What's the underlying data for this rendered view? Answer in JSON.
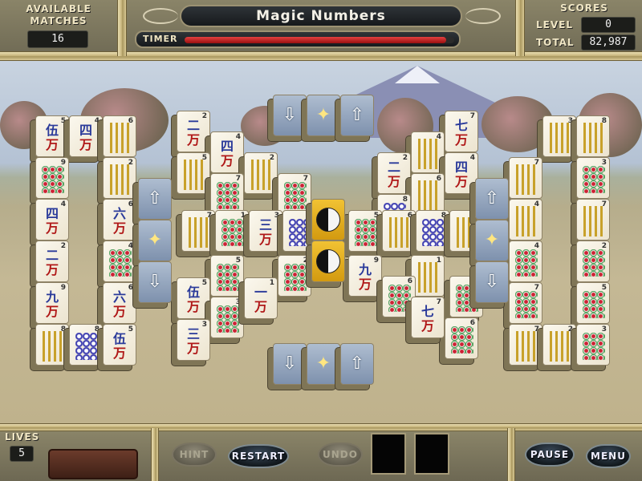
{
  "header": {
    "available_matches_label": "AVAILABLE\nMATCHES",
    "available_matches_value": "16",
    "title": "Magic Numbers",
    "timer_label": "TIMER",
    "timer_fraction": 0.97,
    "scores_label": "SCORES",
    "level_label": "LEVEL",
    "level_value": "0",
    "total_label": "TOTAL",
    "total_value": "82,987"
  },
  "footer": {
    "lives_label": "LIVES",
    "lives_value": "5",
    "hint_label": "HINT",
    "restart_label": "RESTART",
    "undo_label": "UNDO",
    "pause_label": "PAUSE",
    "menu_label": "MENU"
  },
  "colors": {
    "timer_bar": "#c41a1a",
    "special_tile": "#8ea0bb",
    "yin_yang_tile": "#e2ad1f"
  },
  "tiles": [
    {
      "id": "t1",
      "kind": "char",
      "glyph": "伍",
      "sub": "万",
      "num": "5"
    },
    {
      "id": "t2",
      "kind": "char",
      "glyph": "四",
      "sub": "万",
      "num": "4"
    },
    {
      "id": "t3",
      "kind": "bam",
      "num": "6"
    },
    {
      "id": "t4",
      "kind": "circ",
      "num": "9"
    },
    {
      "id": "t5",
      "kind": "bam",
      "num": "2"
    },
    {
      "id": "t6",
      "kind": "char",
      "glyph": "四",
      "sub": "万",
      "num": "4"
    },
    {
      "id": "t7",
      "kind": "char",
      "glyph": "六",
      "sub": "万",
      "num": "6"
    },
    {
      "id": "t8",
      "kind": "char",
      "glyph": "二",
      "sub": "万",
      "num": "2"
    },
    {
      "id": "t9",
      "kind": "circ",
      "num": "4"
    },
    {
      "id": "t10",
      "kind": "char",
      "glyph": "九",
      "sub": "万",
      "num": "9"
    },
    {
      "id": "t11",
      "kind": "char",
      "glyph": "六",
      "sub": "万",
      "num": "6"
    },
    {
      "id": "t12",
      "kind": "bam",
      "num": "8"
    },
    {
      "id": "t13",
      "kind": "circb",
      "num": "8"
    },
    {
      "id": "t14",
      "kind": "char",
      "glyph": "伍",
      "sub": "万",
      "num": "5"
    },
    {
      "id": "t15",
      "kind": "char",
      "glyph": "二",
      "sub": "万",
      "num": "2"
    },
    {
      "id": "t16",
      "kind": "char",
      "glyph": "四",
      "sub": "万",
      "num": "4"
    },
    {
      "id": "t17",
      "kind": "bam",
      "num": "5"
    },
    {
      "id": "t18",
      "kind": "bam",
      "num": "2"
    },
    {
      "id": "t19",
      "kind": "circ",
      "num": "7"
    },
    {
      "id": "t20",
      "kind": "circ",
      "num": "7"
    },
    {
      "id": "t21",
      "kind": "bam",
      "num": "7"
    },
    {
      "id": "t22",
      "kind": "circ",
      "num": "1"
    },
    {
      "id": "t23",
      "kind": "char",
      "glyph": "三",
      "sub": "万",
      "num": "3"
    },
    {
      "id": "t24",
      "kind": "circb",
      "num": "8"
    },
    {
      "id": "t25",
      "kind": "circ",
      "num": "5"
    },
    {
      "id": "t26",
      "kind": "circ",
      "num": "2"
    },
    {
      "id": "t27",
      "kind": "char",
      "glyph": "伍",
      "sub": "万",
      "num": "5"
    },
    {
      "id": "t28",
      "kind": "circ",
      "num": "3"
    },
    {
      "id": "t29",
      "kind": "char",
      "glyph": "一",
      "sub": "万",
      "num": "1"
    },
    {
      "id": "t30",
      "kind": "char",
      "glyph": "三",
      "sub": "万",
      "num": "3"
    },
    {
      "id": "t31",
      "kind": "char",
      "glyph": "七",
      "sub": "万",
      "num": "7"
    },
    {
      "id": "t32",
      "kind": "bam",
      "num": "4"
    },
    {
      "id": "t33",
      "kind": "char",
      "glyph": "二",
      "sub": "万",
      "num": "2"
    },
    {
      "id": "t34",
      "kind": "char",
      "glyph": "四",
      "sub": "万",
      "num": "4"
    },
    {
      "id": "t35",
      "kind": "bam",
      "num": "6"
    },
    {
      "id": "t36",
      "kind": "circb",
      "num": "8"
    },
    {
      "id": "t37",
      "kind": "circ",
      "num": "5"
    },
    {
      "id": "t38",
      "kind": "bam",
      "num": "6"
    },
    {
      "id": "t39",
      "kind": "circb",
      "num": "8"
    },
    {
      "id": "t40",
      "kind": "bam",
      "num": "5"
    },
    {
      "id": "t41",
      "kind": "char",
      "glyph": "九",
      "sub": "万",
      "num": "9"
    },
    {
      "id": "t42",
      "kind": "bam",
      "num": "1"
    },
    {
      "id": "t43",
      "kind": "circ",
      "num": "6"
    },
    {
      "id": "t44",
      "kind": "circ",
      "num": "6"
    },
    {
      "id": "t45",
      "kind": "circ",
      "num": "6"
    },
    {
      "id": "t46",
      "kind": "char",
      "glyph": "七",
      "sub": "万",
      "num": "7"
    },
    {
      "id": "t47",
      "kind": "bam",
      "num": "3"
    },
    {
      "id": "t48",
      "kind": "bam",
      "num": "8"
    },
    {
      "id": "t49",
      "kind": "bam",
      "num": "7"
    },
    {
      "id": "t50",
      "kind": "circ",
      "num": "3"
    },
    {
      "id": "t51",
      "kind": "bam",
      "num": "4"
    },
    {
      "id": "t52",
      "kind": "bam",
      "num": "7"
    },
    {
      "id": "t53",
      "kind": "circ",
      "num": "4"
    },
    {
      "id": "t54",
      "kind": "circ",
      "num": "2"
    },
    {
      "id": "t55",
      "kind": "circ",
      "num": "7"
    },
    {
      "id": "t56",
      "kind": "circ",
      "num": "5"
    },
    {
      "id": "t57",
      "kind": "bam",
      "num": "7"
    },
    {
      "id": "t58",
      "kind": "bam",
      "num": "2"
    },
    {
      "id": "t59",
      "kind": "circ",
      "num": "3"
    }
  ],
  "specials": [
    {
      "id": "s1",
      "kind": "arrow-down"
    },
    {
      "id": "s2",
      "kind": "wand"
    },
    {
      "id": "s3",
      "kind": "arrow-up"
    },
    {
      "id": "s4",
      "kind": "arrow-up"
    },
    {
      "id": "s5",
      "kind": "wand"
    },
    {
      "id": "s6",
      "kind": "arrow-down"
    },
    {
      "id": "s7",
      "kind": "yin-yang"
    },
    {
      "id": "s8",
      "kind": "yin-yang"
    },
    {
      "id": "s9",
      "kind": "arrow-up"
    },
    {
      "id": "s10",
      "kind": "wand"
    },
    {
      "id": "s11",
      "kind": "arrow-down"
    },
    {
      "id": "s12",
      "kind": "arrow-down"
    },
    {
      "id": "s13",
      "kind": "wand"
    },
    {
      "id": "s14",
      "kind": "arrow-up"
    }
  ]
}
